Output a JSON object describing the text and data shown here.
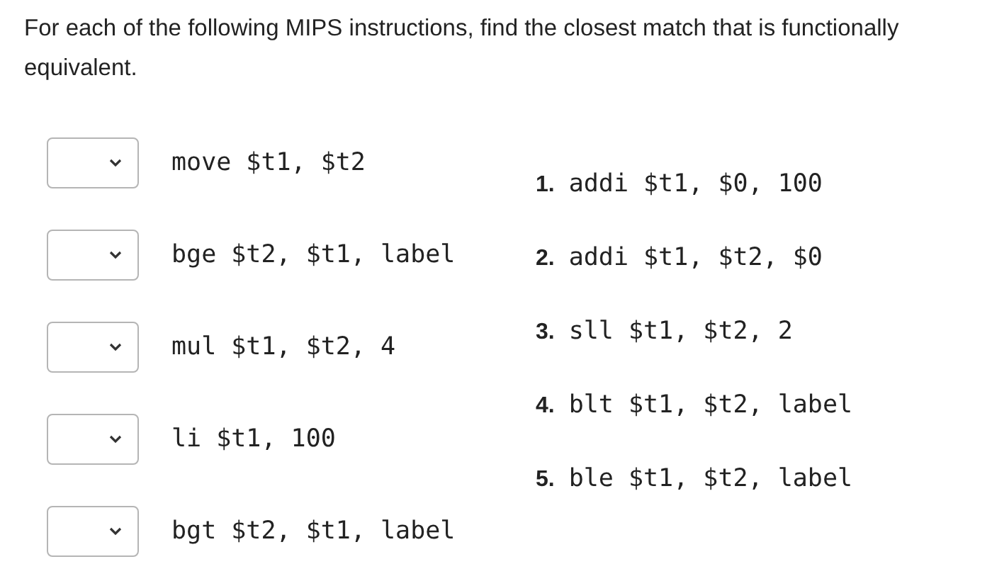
{
  "question": "For each of the following MIPS instructions, find the closest match that is functionally equivalent.",
  "items": [
    {
      "instruction": "move $t1, $t2"
    },
    {
      "instruction": "bge $t2, $t1, label"
    },
    {
      "instruction": "mul $t1, $t2, 4"
    },
    {
      "instruction": "li $t1, 100"
    },
    {
      "instruction": "bgt $t2, $t1, label"
    }
  ],
  "options": [
    {
      "number": "1.",
      "text": "addi $t1, $0, 100"
    },
    {
      "number": "2.",
      "text": "addi $t1, $t2, $0"
    },
    {
      "number": "3.",
      "text": "sll $t1, $t2, 2"
    },
    {
      "number": "4.",
      "text": "blt $t1, $t2, label"
    },
    {
      "number": "5.",
      "text": "ble $t1, $t2, label"
    }
  ]
}
